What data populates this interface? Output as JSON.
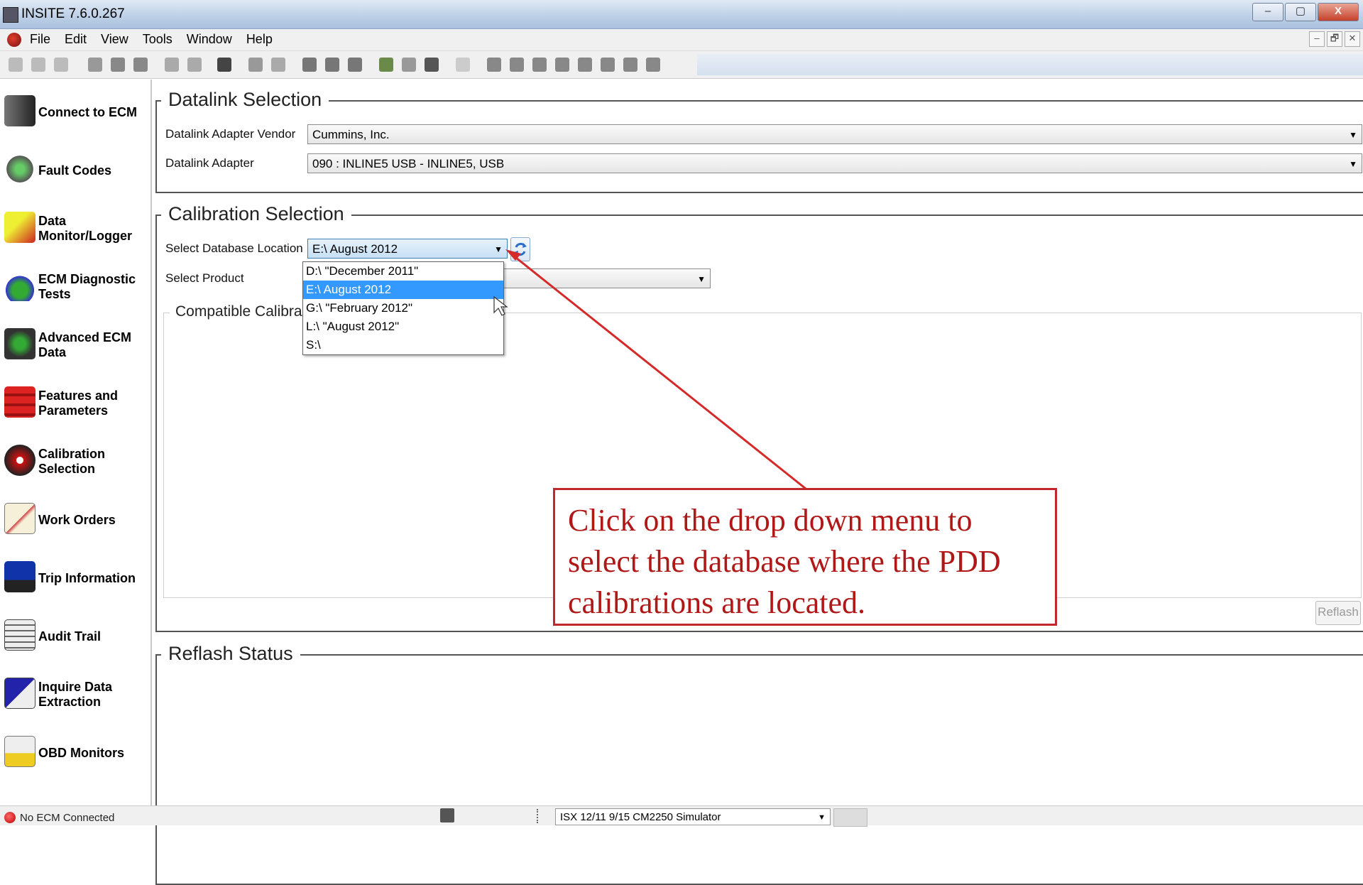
{
  "window": {
    "title": "INSITE 7.6.0.267",
    "minimize": "–",
    "maximize": "▢",
    "close": "X"
  },
  "menu": {
    "items": [
      "File",
      "Edit",
      "View",
      "Tools",
      "Window",
      "Help"
    ],
    "mdi_min": "–",
    "mdi_restore": "🗗",
    "mdi_close": "✕"
  },
  "sidebar": {
    "items": [
      {
        "label": "Connect to ECM",
        "icon": "ecm-connector-icon"
      },
      {
        "label": "Fault Codes",
        "icon": "fault-codes-icon"
      },
      {
        "label": "Data Monitor/Logger",
        "icon": "data-monitor-icon"
      },
      {
        "label": "ECM Diagnostic Tests",
        "icon": "diagnostic-flask-icon"
      },
      {
        "label": "Advanced ECM Data",
        "icon": "advanced-ecm-data-icon"
      },
      {
        "label": "Features and Parameters",
        "icon": "features-parameters-icon"
      },
      {
        "label": "Calibration Selection",
        "icon": "calibration-disc-icon"
      },
      {
        "label": "Work Orders",
        "icon": "work-orders-icon"
      },
      {
        "label": "Trip Information",
        "icon": "trip-truck-icon"
      },
      {
        "label": "Audit Trail",
        "icon": "audit-trail-icon"
      },
      {
        "label": "Inquire Data Extraction",
        "icon": "inquire-extraction-icon"
      },
      {
        "label": "OBD Monitors",
        "icon": "obd-monitors-icon"
      }
    ]
  },
  "datalink": {
    "title": "Datalink Selection",
    "vendor_label": "Datalink Adapter Vendor",
    "vendor_value": "Cummins, Inc.",
    "adapter_label": "Datalink Adapter",
    "adapter_value": "090 : INLINE5 USB - INLINE5, USB"
  },
  "calibration": {
    "title": "Calibration Selection",
    "db_label": "Select Database Location",
    "db_value": "E:\\ August 2012",
    "product_label": "Select Product",
    "compatible_title": "Compatible Calibrati",
    "db_options": [
      "D:\\ \"December 2011\"",
      "E:\\ August 2012",
      "G:\\ \"February 2012\"",
      "L:\\ \"August 2012\"",
      "S:\\"
    ],
    "selected_option_index": 1,
    "reflash_button": "Reflash"
  },
  "reflash_status": {
    "title": "Reflash Status"
  },
  "callout": {
    "text": "Click on the drop down menu to select the database where the PDD calibrations are located.",
    "color": "#b01818"
  },
  "statusbar": {
    "connection": "No ECM Connected",
    "simulator": "ISX 12/11 9/15 CM2250 Simulator"
  }
}
